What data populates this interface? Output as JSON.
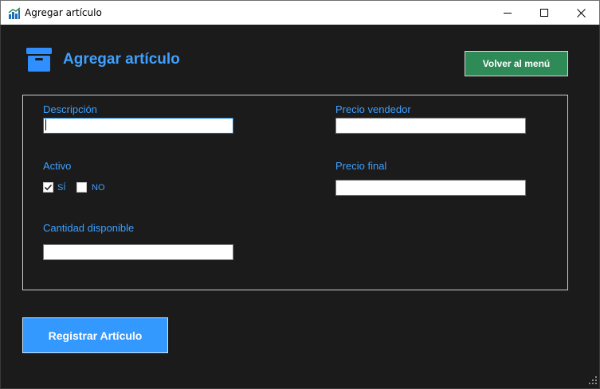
{
  "window": {
    "title": "Agregar artículo",
    "icon": "chart-bars-icon",
    "controls": [
      "minimize-icon",
      "maximize-icon",
      "close-icon"
    ]
  },
  "header": {
    "icon": "archive-box-icon",
    "title": "Agregar artículo",
    "back_label": "Volver al menú"
  },
  "form": {
    "descripcion": {
      "label": "Descripción",
      "value": ""
    },
    "precio_vendedor": {
      "label": "Precio vendedor",
      "value": ""
    },
    "activo": {
      "label": "Activo",
      "options": [
        {
          "label": "SÍ",
          "checked": true
        },
        {
          "label": "NO",
          "checked": false
        }
      ]
    },
    "precio_final": {
      "label": "Precio final",
      "value": ""
    },
    "cantidad": {
      "label": "Cantidad disponible",
      "value": ""
    }
  },
  "actions": {
    "register_label": "Registrar Artículo"
  },
  "colors": {
    "accent": "#3ea0ff",
    "background": "#1b1b1c",
    "back_button": "#2e8b57",
    "register_button": "#3399ff"
  }
}
